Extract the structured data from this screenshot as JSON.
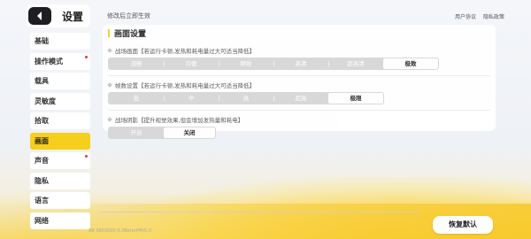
{
  "header": {
    "title": "设置",
    "hint": "修改后立即生效",
    "links": [
      "用户协议",
      "隐私政策"
    ]
  },
  "sidebar": {
    "items": [
      {
        "label": "基础",
        "active": false,
        "dot": false
      },
      {
        "label": "操作模式",
        "active": false,
        "dot": true
      },
      {
        "label": "载具",
        "active": false,
        "dot": false
      },
      {
        "label": "灵敏度",
        "active": false,
        "dot": false
      },
      {
        "label": "拾取",
        "active": false,
        "dot": false
      },
      {
        "label": "画面",
        "active": true,
        "dot": false
      },
      {
        "label": "声音",
        "active": false,
        "dot": true
      },
      {
        "label": "隐私",
        "active": false,
        "dot": false
      },
      {
        "label": "语言",
        "active": false,
        "dot": false
      },
      {
        "label": "网络",
        "active": false,
        "dot": false
      }
    ]
  },
  "panel": {
    "title": "画面设置",
    "sections": [
      {
        "label": "战场画面【若运行卡顿,发热和耗电量过大可适当降低】",
        "options": [
          "流畅",
          "均衡",
          "精致",
          "高清",
          "超高清",
          "极致"
        ],
        "selected": 5
      },
      {
        "label": "帧数设置【若运行卡顿,发热和耗电量过大可适当降低】",
        "options": [
          "低",
          "中",
          "高",
          "超高",
          "极限"
        ],
        "selected": 4
      },
      {
        "label": "战场阴影【提升视觉效果,但会增加发热量和耗电】",
        "options": [
          "开启",
          "关闭"
        ],
        "selected": 1
      }
    ]
  },
  "footer": {
    "version": "AB 0603000 0.0Beta(PM)5.0",
    "reset_label": "恢复默认"
  }
}
